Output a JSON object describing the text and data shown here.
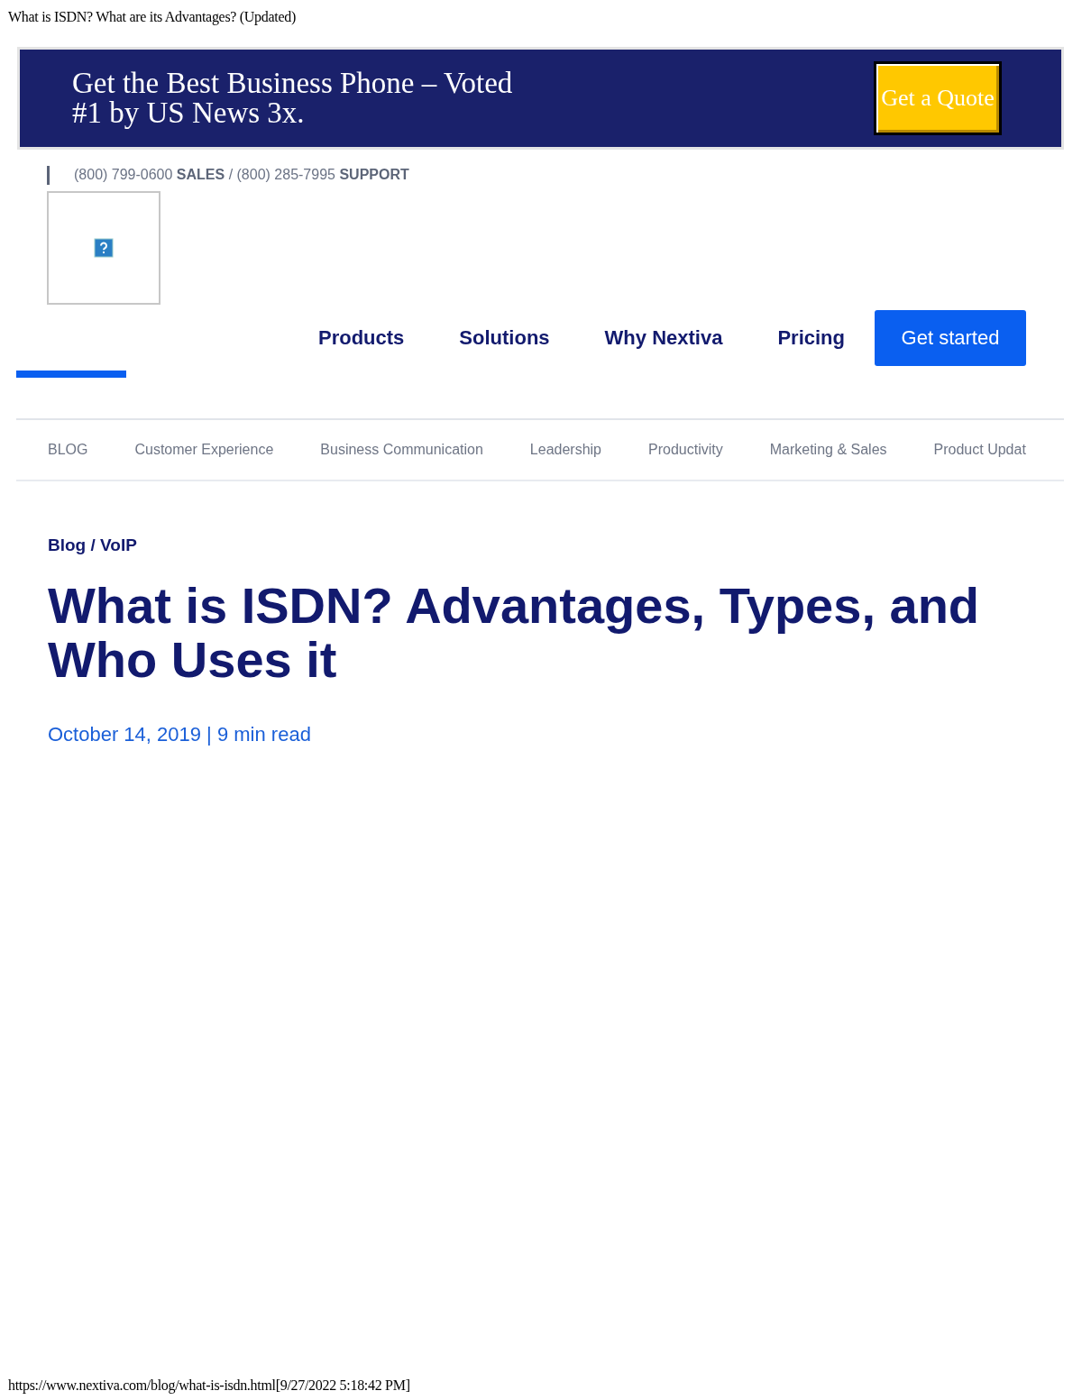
{
  "print_header": "What is ISDN? What are its Advantages? (Updated)",
  "banner": {
    "text": "Get the Best Business Phone – Voted #1 by US News 3x.",
    "button": "Get a Quote"
  },
  "contact_line": "(800) 799-0600 **SALES** / (800) 285-7995 **SUPPORT**",
  "logo": {
    "kind": "broken_image"
  },
  "main_nav": {
    "items": [
      {
        "label": "Products"
      },
      {
        "label": "Solutions"
      },
      {
        "label": "Why Nextiva"
      },
      {
        "label": "Pricing"
      }
    ],
    "button": "Get started"
  },
  "category_nav": [
    {
      "label": "BLOG"
    },
    {
      "label": "Customer Experience"
    },
    {
      "label": "Business Communication"
    },
    {
      "label": "Leadership"
    },
    {
      "label": "Productivity"
    },
    {
      "label": "Marketing & Sales"
    },
    {
      "label": "Product Updat"
    }
  ],
  "article": {
    "breadcrumb": "Blog / VoIP",
    "title": "What is ISDN? Advantages, Types, and Who Uses it",
    "meta": "October 14, 2019 | 9 min read"
  },
  "print_footer": "https://www.nextiva.com/blog/what-is-isdn.html[9/27/2022 5:18:42 PM]"
}
